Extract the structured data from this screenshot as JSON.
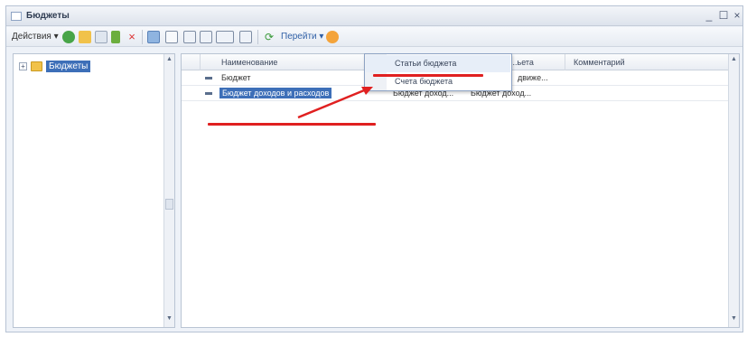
{
  "window": {
    "title": "Бюджеты",
    "minimize_glyph": "_",
    "maximize_glyph": "☐",
    "close_glyph": "×"
  },
  "toolbar": {
    "actions_label": "Действия ▾",
    "goto_label": "Перейти ▾",
    "icons": [
      "add-icon",
      "folder-add-icon",
      "copy-icon",
      "edit-icon",
      "delete-icon",
      "tree-icon",
      "search-icon",
      "filter-icon",
      "filter-clear-icon",
      "sort-icon",
      "refresh-icon",
      "help-icon"
    ]
  },
  "tree": {
    "expander": "+",
    "root_label": "Бюджеты"
  },
  "grid": {
    "columns": [
      "Наименование",
      "Статьи бюджета",
      "Комментарий"
    ],
    "rows": [
      {
        "name": "Бюджет",
        "col2": "",
        "col3": "движе..."
      },
      {
        "name": "Бюджет доходов и расходов",
        "col2": "Бюджет доход...",
        "col3": "Бюджет доход..."
      }
    ],
    "visible_partial_header": "...ьета"
  },
  "goto_menu": {
    "items": [
      "Статьи бюджета",
      "Счета бюджета"
    ]
  },
  "colors": {
    "selection": "#3d6fb8",
    "annotation": "#e02020"
  }
}
